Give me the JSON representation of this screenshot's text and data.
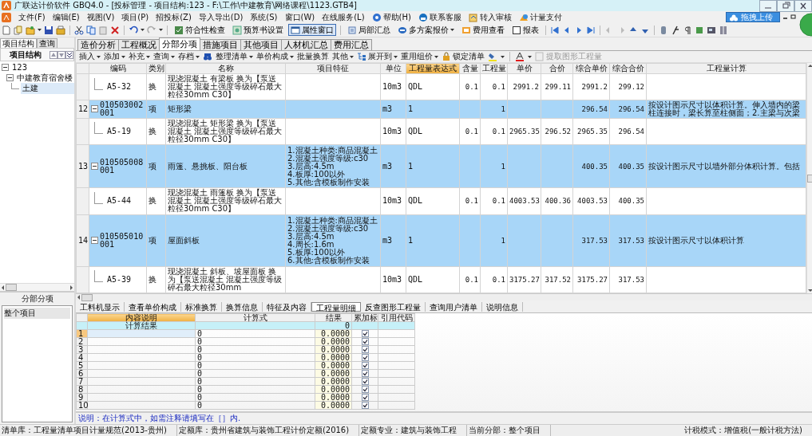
{
  "window": {
    "title": "广联达计价软件 GBQ4.0 - [投标管理 - 项目结构:123 - F:\\工作\\中建教育\\网络课程\\1123.GTB4]",
    "upload_button": "拖拽上传"
  },
  "menu": [
    "文件(F)",
    "编辑(E)",
    "视图(V)",
    "项目(P)",
    "招投标(Z)",
    "导入导出(D)",
    "系统(S)",
    "窗口(W)",
    "在线服务(L)",
    "帮助(H)",
    "联系客服",
    "转入审核",
    "计量支付"
  ],
  "toolbar": [
    {
      "label": "符合性检查",
      "on": false
    },
    {
      "label": "预算书设置",
      "on": false
    },
    {
      "label": "属性窗口",
      "on": true
    },
    {
      "label": "局部汇总",
      "on": false
    },
    {
      "label": "多方案报价",
      "on": false
    },
    {
      "label": "费用查看",
      "on": false
    },
    {
      "label": "报表",
      "on": false
    }
  ],
  "left": {
    "tabs": [
      {
        "label": "项目结构",
        "selected": true
      },
      {
        "label": "查询",
        "selected": false
      }
    ],
    "header": "项目结构",
    "tree": [
      {
        "label": "123",
        "expanded": true,
        "selected": false,
        "children": [
          {
            "label": "中建教育宿舍楼",
            "expanded": true,
            "selected": false,
            "children": [
              {
                "label": "土建",
                "selected": true
              }
            ]
          }
        ]
      }
    ],
    "lower": {
      "header": "分部分项",
      "items": [
        {
          "label": "整个项目",
          "selected": true
        }
      ]
    }
  },
  "tabs": [
    {
      "label": "造价分析",
      "selected": false
    },
    {
      "label": "工程概况",
      "selected": false
    },
    {
      "label": "分部分项",
      "selected": true
    },
    {
      "label": "措施项目",
      "selected": false
    },
    {
      "label": "其他项目",
      "selected": false
    },
    {
      "label": "人材机汇总",
      "selected": false
    },
    {
      "label": "费用汇总",
      "selected": false
    }
  ],
  "actions": [
    {
      "label": "插入",
      "dropdown": true,
      "disabled": false
    },
    {
      "label": "添加",
      "dropdown": true,
      "disabled": false
    },
    {
      "label": "补充",
      "dropdown": true,
      "disabled": false
    },
    {
      "label": "查询",
      "dropdown": true,
      "disabled": false
    },
    {
      "label": "存档",
      "dropdown": true,
      "disabled": false
    },
    {
      "label": "整理清单",
      "dropdown": true,
      "disabled": false
    },
    {
      "label": "单价构成",
      "dropdown": true,
      "disabled": false
    },
    {
      "label": "批量换算",
      "dropdown": false,
      "disabled": false
    },
    {
      "label": "其他",
      "dropdown": true,
      "disabled": false
    },
    {
      "label": "展开到",
      "dropdown": true,
      "disabled": false
    },
    {
      "label": "重用组价",
      "dropdown": true,
      "disabled": false
    },
    {
      "label": "锁定清单",
      "dropdown": false,
      "disabled": false
    },
    {
      "label": "提取图形工程量",
      "dropdown": false,
      "disabled": true
    }
  ],
  "table": {
    "columns": [
      {
        "label": "编码",
        "selected": false
      },
      {
        "label": "类别",
        "selected": false
      },
      {
        "label": "名称",
        "selected": false
      },
      {
        "label": "项目特征",
        "selected": false
      },
      {
        "label": "单位",
        "selected": false
      },
      {
        "label": "工程量表达式",
        "selected": true
      },
      {
        "label": "含量",
        "selected": false
      },
      {
        "label": "工程量",
        "selected": false
      },
      {
        "label": "单价",
        "selected": false
      },
      {
        "label": "合价",
        "selected": false
      },
      {
        "label": "综合单价",
        "selected": false
      },
      {
        "label": "综合合价",
        "selected": false
      },
      {
        "label": "工程量计算",
        "selected": false
      }
    ],
    "rows": [
      {
        "kind": "sub",
        "code": "A5-32",
        "type": "换",
        "name": "现浇混凝土 有梁板 换为【泵送混凝土 混凝土强度等级碎石最大粒径30mm C30】",
        "unit": "10m3",
        "expression": "QDL",
        "content": "0.1",
        "quantity": "0.1",
        "unit_price": "2991.2",
        "price": "299.11",
        "composite_unit_price": "2991.2",
        "composite_price": "299.12"
      },
      {
        "kind": "item",
        "number": "12",
        "expanded": true,
        "code": "010503002001",
        "type": "项",
        "name": "矩形梁",
        "unit": "m3",
        "expression": "1",
        "quantity": "1",
        "composite_unit_price": "296.54",
        "composite_price": "296.54",
        "calc": [
          "按设计图示尺寸以体积计算。伸入墙内的梁",
          "柱连接时，梁长算至柱侧面；2.主梁与次梁"
        ]
      },
      {
        "kind": "sub",
        "code": "A5-19",
        "type": "换",
        "name": "现浇混凝土 矩形梁 换为【泵送混凝土 混凝土强度等级碎石最大粒径30mm C30】",
        "unit": "10m3",
        "expression": "QDL",
        "content": "0.1",
        "quantity": "0.1",
        "unit_price": "2965.35",
        "price": "296.52",
        "composite_unit_price": "2965.35",
        "composite_price": "296.54"
      },
      {
        "kind": "item",
        "number": "13",
        "expanded": true,
        "code": "010505008001",
        "type": "项",
        "name": "雨篷、悬挑板、阳台板",
        "features": [
          "1.混凝土种类:商品混凝土",
          "2.混凝土强度等级:c30",
          "3.层高:4.5m",
          "4.板厚:100以外",
          "5.其他:含模板制作安装"
        ],
        "unit": "m3",
        "expression": "1",
        "quantity": "1",
        "composite_unit_price": "400.35",
        "composite_price": "400.35",
        "calc": [
          "按设计图示尺寸以墙外部分体积计算。包括"
        ]
      },
      {
        "kind": "sub",
        "code": "A5-44",
        "type": "换",
        "name": "现浇混凝土 雨篷板 换为【泵送混凝土 混凝土强度等级碎石最大粒径30mm C30】",
        "unit": "10m3",
        "expression": "QDL",
        "content": "0.1",
        "quantity": "0.1",
        "unit_price": "4003.53",
        "price": "400.36",
        "composite_unit_price": "4003.53",
        "composite_price": "400.35"
      },
      {
        "kind": "item",
        "number": "14",
        "expanded": true,
        "code": "010505010001",
        "type": "项",
        "name": "屋面斜板",
        "features": [
          "1.混凝土种类:商品混凝土",
          "2.混凝土强度等级:c30",
          "3.层高:4.5m",
          "4.周长:1.6m",
          "5.板厚:100以外",
          "6.其他:含模板制作安装"
        ],
        "unit": "m3",
        "expression": "1",
        "quantity": "1",
        "composite_unit_price": "317.53",
        "composite_price": "317.53",
        "calc": [
          "按设计图示尺寸以体积计算"
        ]
      },
      {
        "kind": "sub",
        "code": "A5-39",
        "type": "换",
        "name": "现浇混凝土 斜板、坡屋面板 换为【泵送混凝土 混凝土强度等级碎石最大粒径30mm",
        "unit": "10m3",
        "expression": "QDL",
        "content": "0.1",
        "quantity": "0.1",
        "unit_price": "3175.27",
        "price": "317.52",
        "composite_unit_price": "3175.27",
        "composite_price": "317.53"
      }
    ]
  },
  "detail": {
    "tabs": [
      {
        "label": "工料机显示",
        "selected": false
      },
      {
        "label": "查看单价构成",
        "selected": false
      },
      {
        "label": "标准换算",
        "selected": false
      },
      {
        "label": "换算信息",
        "selected": false
      },
      {
        "label": "特征及内容",
        "selected": false
      },
      {
        "label": "工程量明细",
        "selected": true
      },
      {
        "label": "反查图形工程量",
        "selected": false
      },
      {
        "label": "查询用户清单",
        "selected": false
      },
      {
        "label": "说明信息",
        "selected": false
      }
    ],
    "columns": [
      {
        "label": "内容说明",
        "selected": true
      },
      {
        "label": "计算式",
        "selected": false
      },
      {
        "label": "结果",
        "selected": false
      },
      {
        "label": "累加标",
        "selected": false
      },
      {
        "label": "引用代码",
        "selected": false
      }
    ],
    "summary": {
      "label": "计算结果",
      "result": "0"
    },
    "rows": [
      {
        "number": "1",
        "formula": "0",
        "result": "0.0000",
        "accumulate": true,
        "selected": true
      },
      {
        "number": "2",
        "formula": "0",
        "result": "0.0000",
        "accumulate": true,
        "selected": false
      },
      {
        "number": "3",
        "formula": "0",
        "result": "0.0000",
        "accumulate": true,
        "selected": false
      },
      {
        "number": "4",
        "formula": "0",
        "result": "0.0000",
        "accumulate": true,
        "selected": false
      },
      {
        "number": "5",
        "formula": "0",
        "result": "0.0000",
        "accumulate": true,
        "selected": false
      },
      {
        "number": "6",
        "formula": "0",
        "result": "0.0000",
        "accumulate": true,
        "selected": false
      },
      {
        "number": "7",
        "formula": "0",
        "result": "0.0000",
        "accumulate": true,
        "selected": false
      },
      {
        "number": "8",
        "formula": "0",
        "result": "0.0000",
        "accumulate": true,
        "selected": false
      },
      {
        "number": "9",
        "formula": "0",
        "result": "0.0000",
        "accumulate": true,
        "selected": false
      },
      {
        "number": "10",
        "formula": "0",
        "result": "0.0000",
        "accumulate": true,
        "selected": false
      }
    ],
    "note": "说明：在计算式中，如需注释请填写在［］内."
  },
  "status_bar": [
    "清单库：工程量清单项目计量规范(2013-贵州)",
    "定额库：贵州省建筑与装饰工程计价定额(2016)",
    "定额专业：建筑与装饰工程",
    "当前分部：整个项目",
    "计税模式：增值税(一般计税方法)"
  ]
}
